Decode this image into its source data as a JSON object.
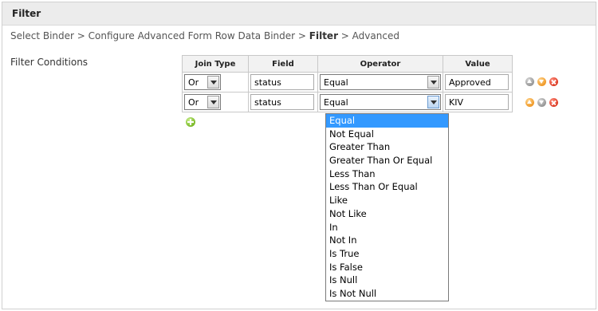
{
  "header": {
    "title": "Filter"
  },
  "breadcrumb": {
    "prefix": "Select Binder > Configure Advanced Form Row Data Binder > ",
    "current": "Filter",
    "suffix": " > Advanced"
  },
  "filter_conditions_label": "Filter Conditions",
  "table": {
    "headers": [
      "Join Type",
      "Field",
      "Operator",
      "Value"
    ],
    "rows": [
      {
        "join": "Or",
        "field": "status",
        "operator": "Equal",
        "value": "Approved"
      },
      {
        "join": "Or",
        "field": "status",
        "operator": "Equal",
        "value": "KIV"
      }
    ]
  },
  "operator_options": [
    "Equal",
    "Not Equal",
    "Greater Than",
    "Greater Than Or Equal",
    "Less Than",
    "Less Than Or Equal",
    "Like",
    "Not Like",
    "In",
    "Not In",
    "Is True",
    "Is False",
    "Is Null",
    "Is Not Null"
  ],
  "icons": {
    "up": "arrow-up-icon",
    "down": "arrow-down-icon",
    "delete": "delete-icon",
    "add": "add-icon"
  },
  "colors": {
    "selected_option": "#3399ff",
    "add": "#5aa300",
    "move": "#e98200",
    "delete": "#cc1a00"
  }
}
